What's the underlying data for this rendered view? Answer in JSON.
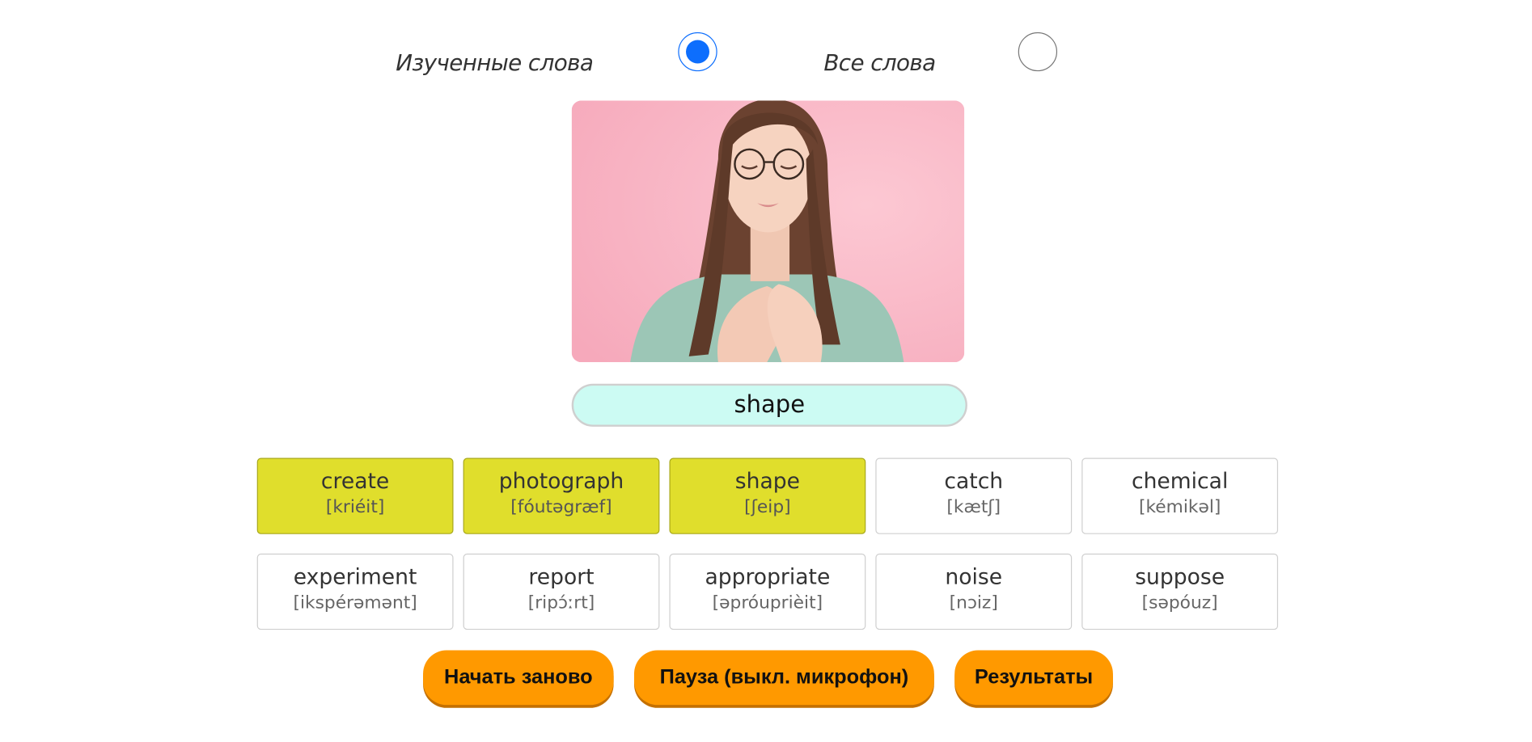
{
  "mode": {
    "learned_label": "Изученные слова",
    "all_label": "Все слова",
    "selected": "learned"
  },
  "picture": {
    "description_icon": "woman-hands-on-heart-photo"
  },
  "answer_value": "shape",
  "words": [
    {
      "word": "create",
      "transcription": "[kriéit]",
      "done": true
    },
    {
      "word": "photograph",
      "transcription": "[fóutəgræf]",
      "done": true
    },
    {
      "word": "shape",
      "transcription": "[ʃeip]",
      "done": true
    },
    {
      "word": "catch",
      "transcription": "[kætʃ]",
      "done": false
    },
    {
      "word": "chemical",
      "transcription": "[kémikəl]",
      "done": false
    },
    {
      "word": "experiment",
      "transcription": "[ikspérəmənt]",
      "done": false
    },
    {
      "word": "report",
      "transcription": "[ripɔ́ːrt]",
      "done": false
    },
    {
      "word": "appropriate",
      "transcription": "[əpróuprièit]",
      "done": false
    },
    {
      "word": "noise",
      "transcription": "[nɔiz]",
      "done": false
    },
    {
      "word": "suppose",
      "transcription": "[səpóuz]",
      "done": false
    }
  ],
  "buttons": {
    "restart": "Начать заново",
    "pause": "Пауза (выкл. микрофон)",
    "results": "Результаты"
  },
  "colors": {
    "accent": "#0d6efd",
    "done_card": "#e0de2c",
    "button": "#ff9900",
    "answer_bg": "#ccfbf3",
    "photo_bg": "#f8b4c4"
  }
}
